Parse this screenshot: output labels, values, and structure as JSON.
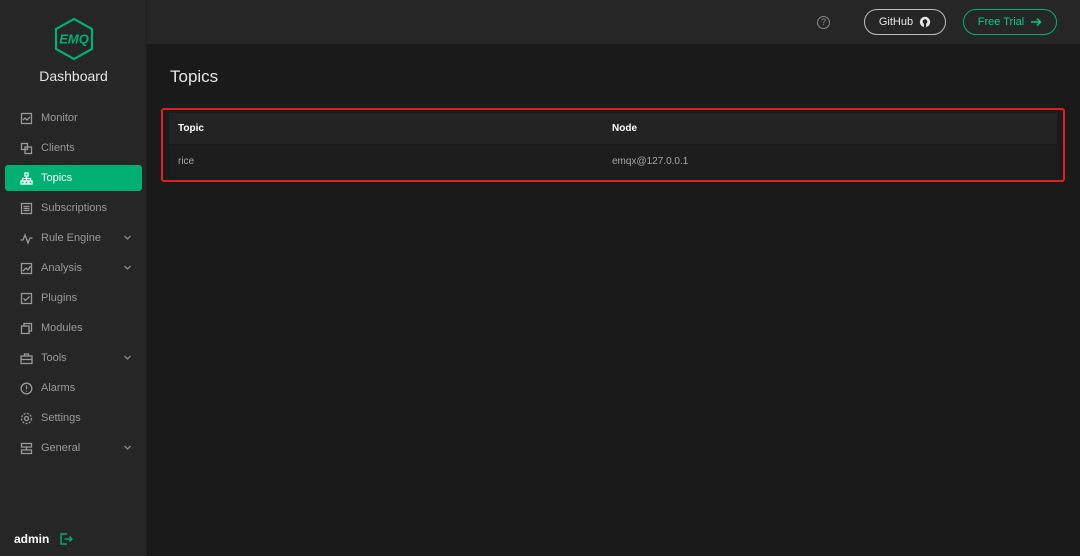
{
  "sidebar": {
    "logo_text": "EMQ",
    "brand": "Dashboard",
    "items": [
      {
        "label": "Monitor",
        "icon": "monitor-icon"
      },
      {
        "label": "Clients",
        "icon": "clients-icon"
      },
      {
        "label": "Topics",
        "icon": "topics-icon",
        "active": true
      },
      {
        "label": "Subscriptions",
        "icon": "subscriptions-icon"
      },
      {
        "label": "Rule Engine",
        "icon": "rule-engine-icon",
        "expandable": true
      },
      {
        "label": "Analysis",
        "icon": "analysis-icon",
        "expandable": true
      },
      {
        "label": "Plugins",
        "icon": "plugins-icon"
      },
      {
        "label": "Modules",
        "icon": "modules-icon"
      },
      {
        "label": "Tools",
        "icon": "tools-icon",
        "expandable": true
      },
      {
        "label": "Alarms",
        "icon": "alarms-icon"
      },
      {
        "label": "Settings",
        "icon": "settings-icon"
      },
      {
        "label": "General",
        "icon": "general-icon",
        "expandable": true
      }
    ],
    "user": "admin"
  },
  "header": {
    "help_glyph": "?",
    "github_label": "GitHub",
    "free_trial_label": "Free Trial"
  },
  "main": {
    "title": "Topics",
    "table": {
      "columns": [
        "Topic",
        "Node"
      ],
      "rows": [
        [
          "rice",
          "emqx@127.0.0.1"
        ]
      ]
    }
  },
  "colors": {
    "accent": "#00b173",
    "highlight_border": "#e02020",
    "sidebar_bg": "#262626",
    "page_bg": "#1a1a1a"
  }
}
